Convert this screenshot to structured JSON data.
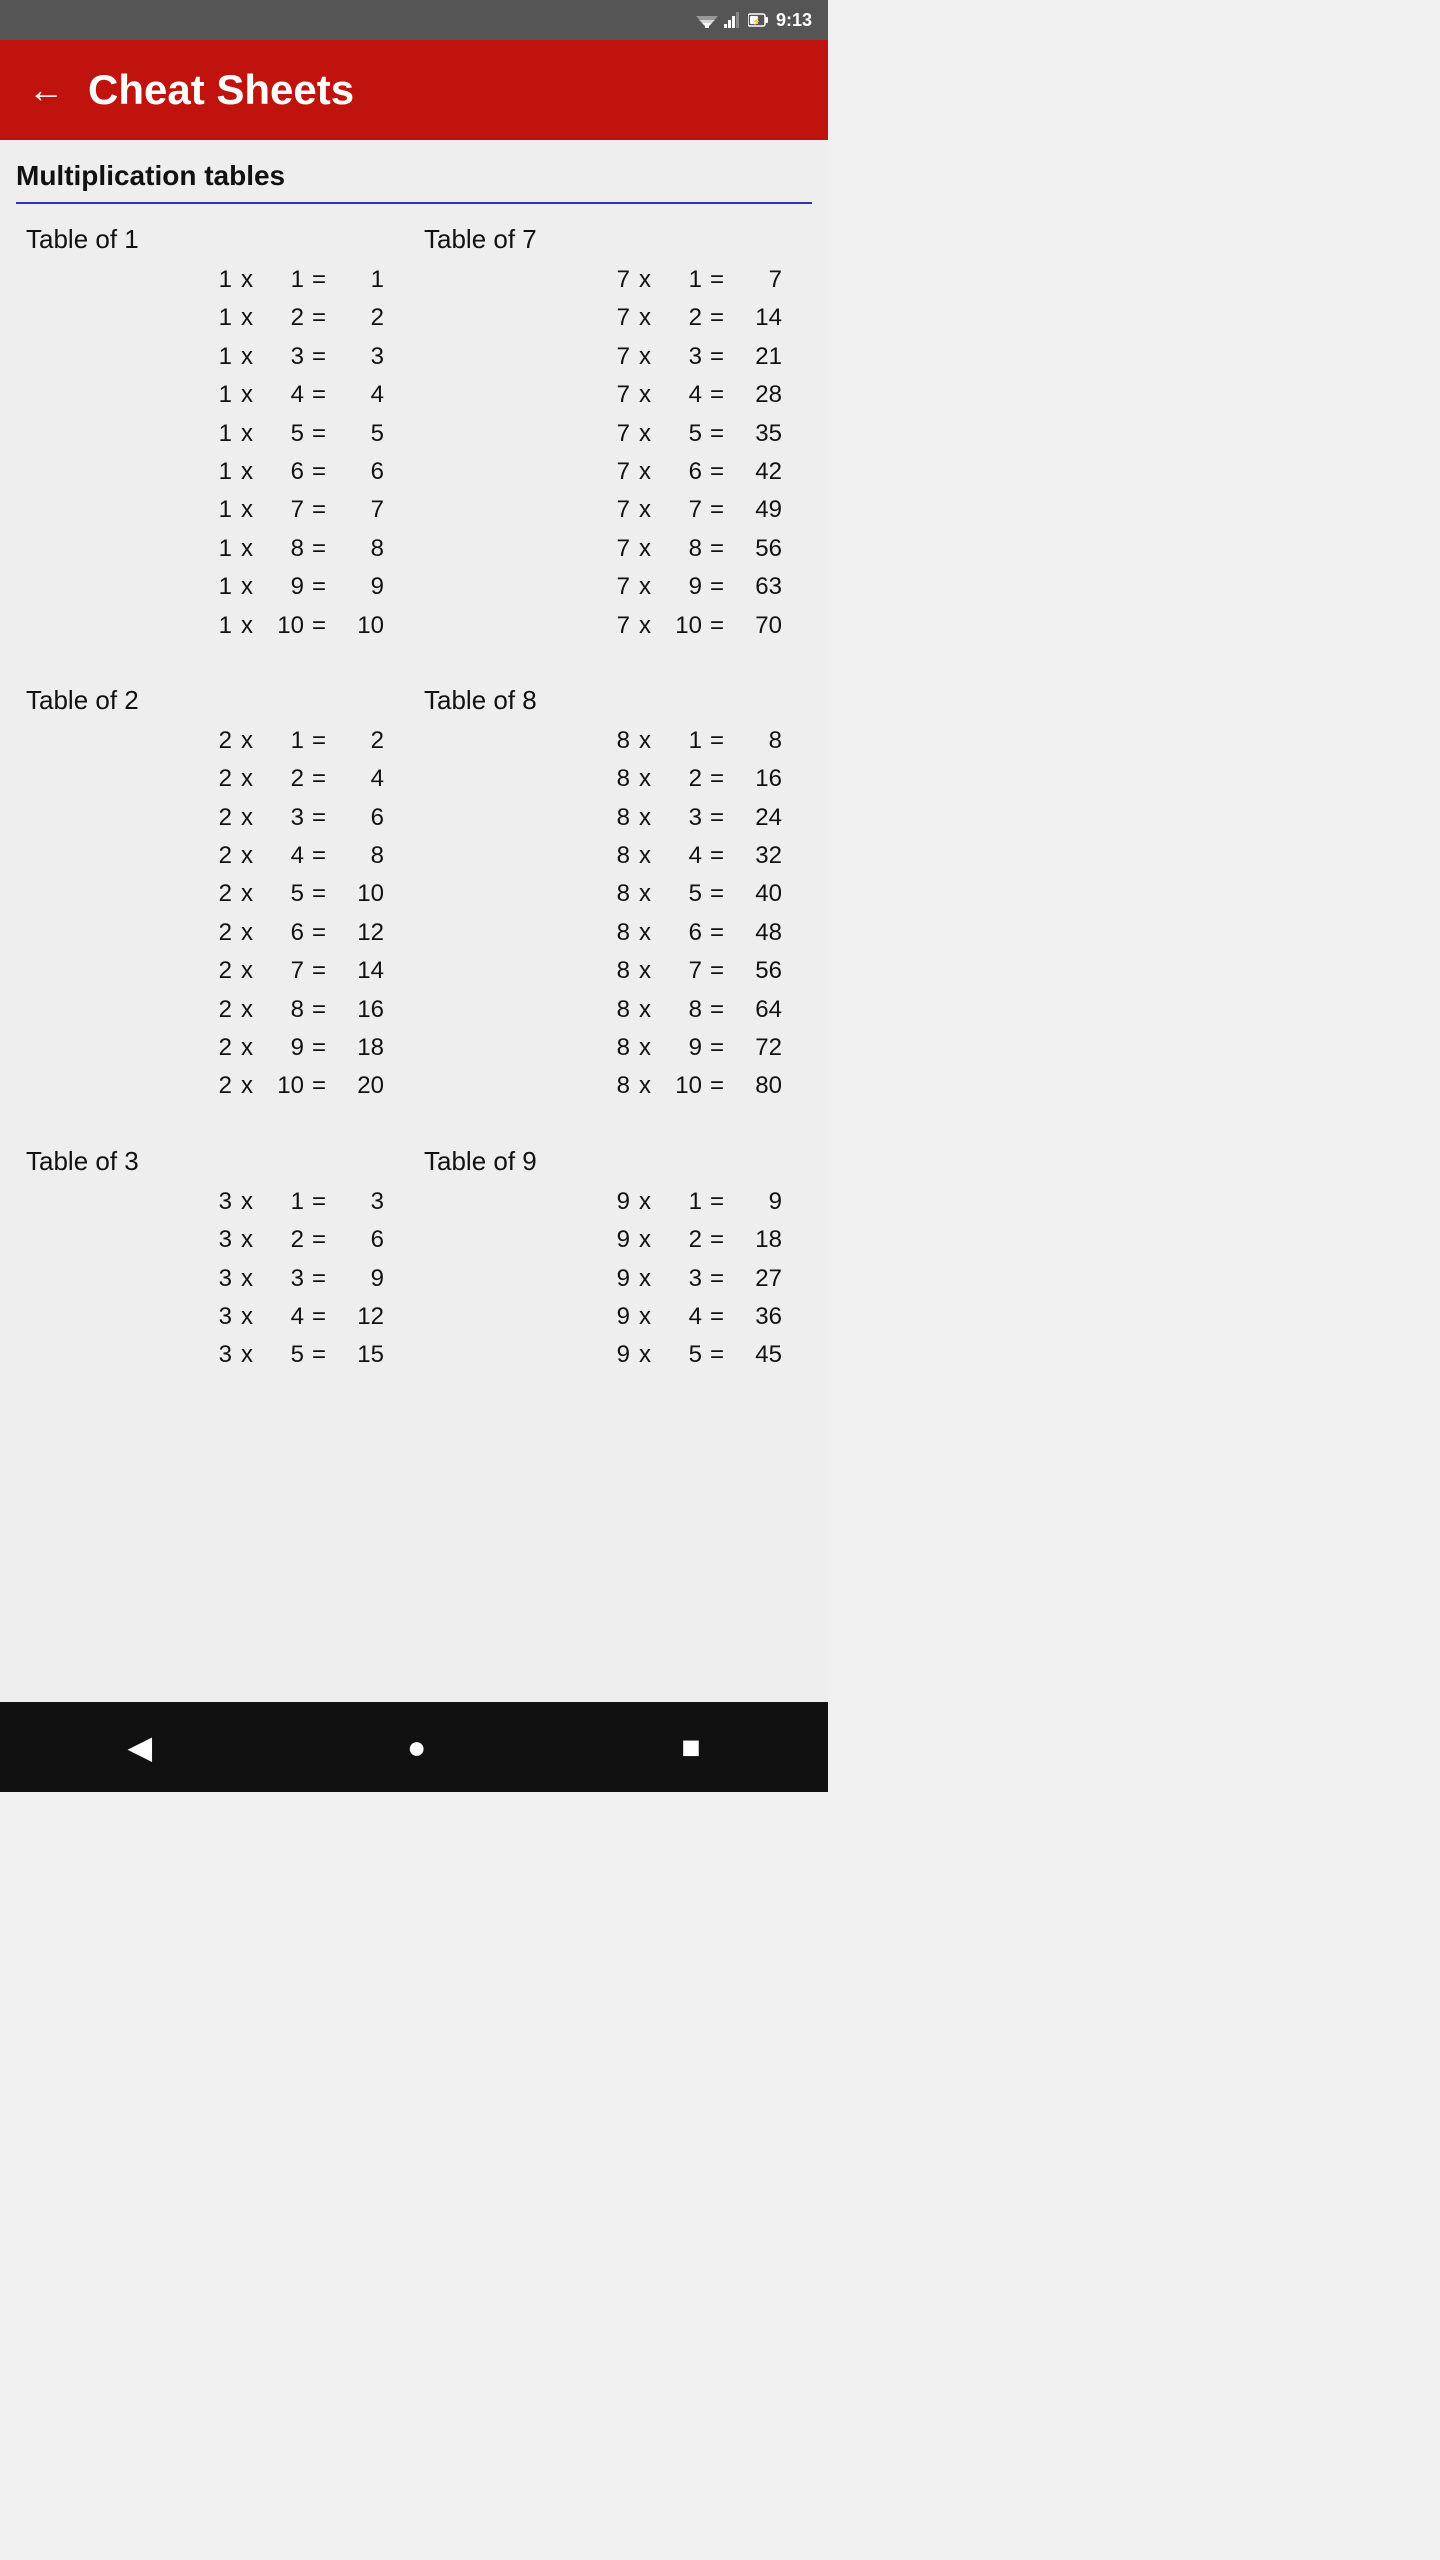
{
  "statusBar": {
    "time": "9:13"
  },
  "appBar": {
    "backLabel": "←",
    "title": "Cheat Sheets"
  },
  "content": {
    "sectionHeader": "Multiplication tables",
    "tablePairs": [
      {
        "left": {
          "title": "Table of 1",
          "base": 1,
          "rows": [
            {
              "n2": 1,
              "result": 1
            },
            {
              "n2": 2,
              "result": 2
            },
            {
              "n2": 3,
              "result": 3
            },
            {
              "n2": 4,
              "result": 4
            },
            {
              "n2": 5,
              "result": 5
            },
            {
              "n2": 6,
              "result": 6
            },
            {
              "n2": 7,
              "result": 7
            },
            {
              "n2": 8,
              "result": 8
            },
            {
              "n2": 9,
              "result": 9
            },
            {
              "n2": 10,
              "result": 10
            }
          ]
        },
        "right": {
          "title": "Table of 7",
          "base": 7,
          "rows": [
            {
              "n2": 1,
              "result": 7
            },
            {
              "n2": 2,
              "result": 14
            },
            {
              "n2": 3,
              "result": 21
            },
            {
              "n2": 4,
              "result": 28
            },
            {
              "n2": 5,
              "result": 35
            },
            {
              "n2": 6,
              "result": 42
            },
            {
              "n2": 7,
              "result": 49
            },
            {
              "n2": 8,
              "result": 56
            },
            {
              "n2": 9,
              "result": 63
            },
            {
              "n2": 10,
              "result": 70
            }
          ]
        }
      },
      {
        "left": {
          "title": "Table of 2",
          "base": 2,
          "rows": [
            {
              "n2": 1,
              "result": 2
            },
            {
              "n2": 2,
              "result": 4
            },
            {
              "n2": 3,
              "result": 6
            },
            {
              "n2": 4,
              "result": 8
            },
            {
              "n2": 5,
              "result": 10
            },
            {
              "n2": 6,
              "result": 12
            },
            {
              "n2": 7,
              "result": 14
            },
            {
              "n2": 8,
              "result": 16
            },
            {
              "n2": 9,
              "result": 18
            },
            {
              "n2": 10,
              "result": 20
            }
          ]
        },
        "right": {
          "title": "Table of 8",
          "base": 8,
          "rows": [
            {
              "n2": 1,
              "result": 8
            },
            {
              "n2": 2,
              "result": 16
            },
            {
              "n2": 3,
              "result": 24
            },
            {
              "n2": 4,
              "result": 32
            },
            {
              "n2": 5,
              "result": 40
            },
            {
              "n2": 6,
              "result": 48
            },
            {
              "n2": 7,
              "result": 56
            },
            {
              "n2": 8,
              "result": 64
            },
            {
              "n2": 9,
              "result": 72
            },
            {
              "n2": 10,
              "result": 80
            }
          ]
        }
      },
      {
        "left": {
          "title": "Table of 3",
          "base": 3,
          "rows": [
            {
              "n2": 1,
              "result": 3
            },
            {
              "n2": 2,
              "result": 6
            },
            {
              "n2": 3,
              "result": 9
            },
            {
              "n2": 4,
              "result": 12
            },
            {
              "n2": 5,
              "result": 15
            }
          ]
        },
        "right": {
          "title": "Table of 9",
          "base": 9,
          "rows": [
            {
              "n2": 1,
              "result": 9
            },
            {
              "n2": 2,
              "result": 18
            },
            {
              "n2": 3,
              "result": 27
            },
            {
              "n2": 4,
              "result": 36
            },
            {
              "n2": 5,
              "result": 45
            }
          ]
        }
      }
    ]
  },
  "navBar": {
    "back": "◀",
    "home": "●",
    "recent": "■"
  }
}
